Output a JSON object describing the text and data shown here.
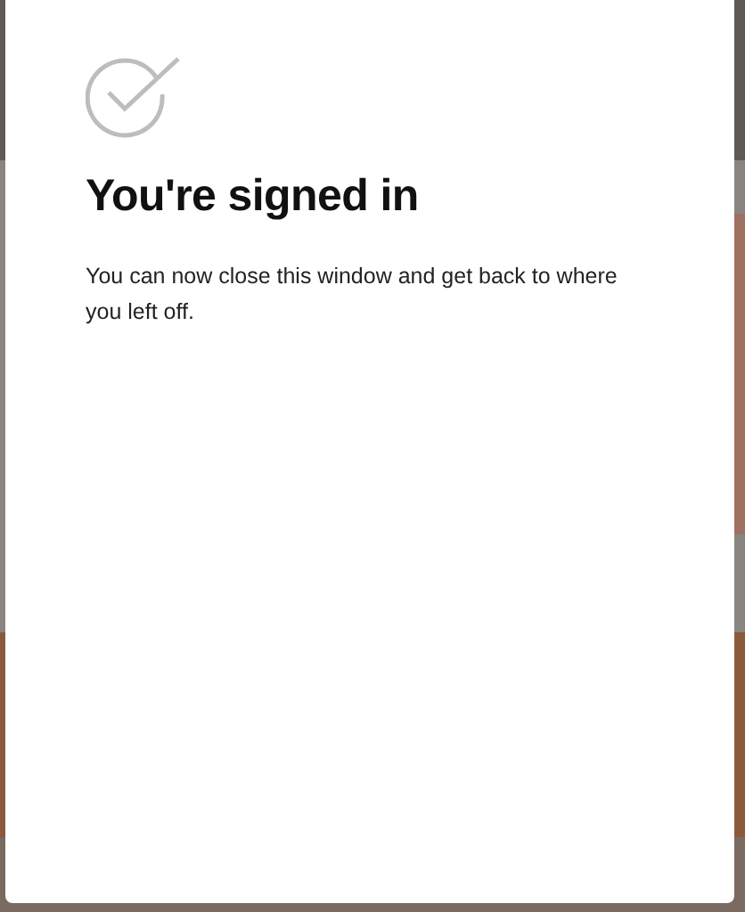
{
  "dialog": {
    "title": "You're signed in",
    "message": "You can now close this window and get back to where you left off."
  }
}
